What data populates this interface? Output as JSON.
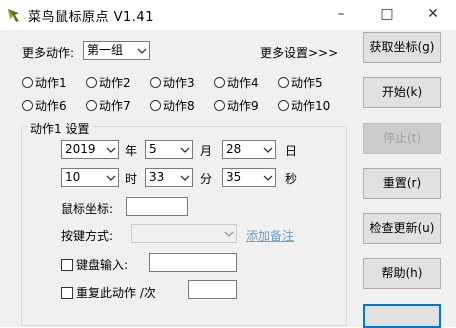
{
  "window": {
    "title": "菜鸟鼠标原点 V1.41"
  },
  "top": {
    "actions_label": "更多动作:",
    "group_select": "第一组",
    "more_settings": "更多设置>>>"
  },
  "radios": [
    "动作1",
    "动作2",
    "动作3",
    "动作4",
    "动作5",
    "动作6",
    "动作7",
    "动作8",
    "动作9",
    "动作10"
  ],
  "settings": {
    "title": "动作1 设置",
    "year": "2019",
    "year_unit": "年",
    "month": "5",
    "month_unit": "月",
    "day": "28",
    "day_unit": "日",
    "hour": "10",
    "hour_unit": "时",
    "minute": "33",
    "minute_unit": "分",
    "second": "35",
    "second_unit": "秒",
    "coords_label": "鼠标坐标:",
    "key_mode_label": "按键方式:",
    "add_note": "添加备注",
    "keyboard_label": "键盘输入:",
    "repeat_label": "重复此动作 /次"
  },
  "buttons": {
    "get_coords": "获取坐标(g)",
    "start": "开始(k)",
    "stop": "停止(t)",
    "reset": "重置(r)",
    "check_update": "检查更新(u)",
    "help": "帮助(h)"
  },
  "colors": {
    "link": "#6fa0c6",
    "focus": "#0078d7"
  }
}
